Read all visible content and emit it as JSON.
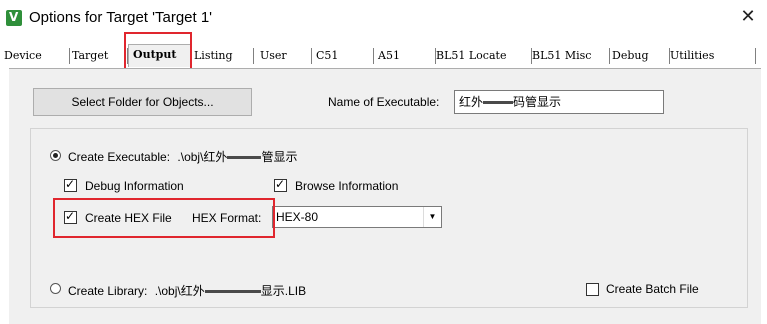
{
  "window": {
    "title": "Options for Target 'Target 1'",
    "close_glyph": "✕"
  },
  "tabs": [
    {
      "label": "Device",
      "active": false
    },
    {
      "label": "Target",
      "active": false
    },
    {
      "label": "Output",
      "active": true
    },
    {
      "label": "Listing",
      "active": false
    },
    {
      "label": "User",
      "active": false
    },
    {
      "label": "C51",
      "active": false
    },
    {
      "label": "A51",
      "active": false
    },
    {
      "label": "BL51 Locate",
      "active": false
    },
    {
      "label": "BL51 Misc",
      "active": false
    },
    {
      "label": "Debug",
      "active": false
    },
    {
      "label": "Utilities",
      "active": false
    }
  ],
  "output": {
    "select_folder_button": "Select Folder for Objects...",
    "name_exec_label": "Name of Executable:",
    "name_exec_value": "红外",
    "name_exec_value_suffix": "码管显示",
    "create_exec_label": "Create Executable:",
    "create_exec_path_prefix": ".\\obj\\红外",
    "create_exec_path_suffix": "管显示",
    "create_exec_checked": true,
    "debug_info_label": "Debug Information",
    "debug_info_checked": true,
    "browse_info_label": "Browse Information",
    "browse_info_checked": true,
    "create_hex_label": "Create HEX File",
    "create_hex_checked": true,
    "hex_format_label": "HEX Format:",
    "hex_format_value": "HEX-80",
    "create_library_label": "Create Library:",
    "create_library_path_prefix": ".\\obj\\红外",
    "create_library_path_suffix": "显示.LIB",
    "create_library_checked": false,
    "create_batch_label": "Create Batch File",
    "create_batch_checked": false
  },
  "colors": {
    "annotation_red": "#e0262e",
    "panel_bg": "#f0f0f0"
  }
}
